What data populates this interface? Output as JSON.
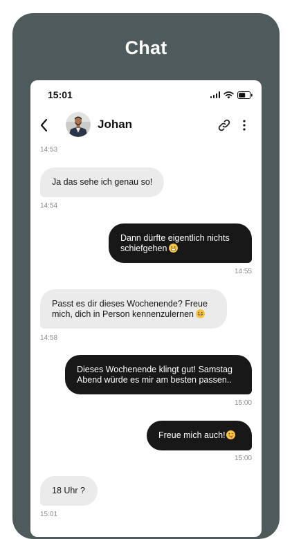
{
  "page": {
    "heading": "Chat"
  },
  "status_bar": {
    "time": "15:01"
  },
  "header": {
    "contact_name": "Johan",
    "back_icon": "chevron-left-icon",
    "link_icon": "link-icon",
    "more_icon": "more-vertical-icon"
  },
  "messages": [
    {
      "direction": "time",
      "time": "14:53"
    },
    {
      "direction": "incoming",
      "text": "Ja das sehe ich genau so!",
      "time": "14:54"
    },
    {
      "direction": "outgoing",
      "text": "Dann dürfte eigentlich nichts schiefgehen",
      "emoji": "grimacing-face",
      "time": "14:55"
    },
    {
      "direction": "incoming",
      "text": "Passt es dir dieses Wochenende? Freue mich, dich in Person kennenzulernen",
      "emoji": "grinning-face",
      "time": "14:58"
    },
    {
      "direction": "outgoing",
      "text": "Dieses Wochenende klingt gut! Samstag Abend würde es mir am besten passen..",
      "time": "15:00"
    },
    {
      "direction": "outgoing",
      "text": "Freue mich auch!",
      "emoji": "winking-tongue-face",
      "time": "15:00"
    },
    {
      "direction": "incoming",
      "text": "18 Uhr ?",
      "time": "15:01"
    }
  ],
  "colors": {
    "card_background": "#4f5b5b",
    "incoming_bubble": "#ebebeb",
    "outgoing_bubble": "#181818",
    "emoji": "#f4c542"
  }
}
